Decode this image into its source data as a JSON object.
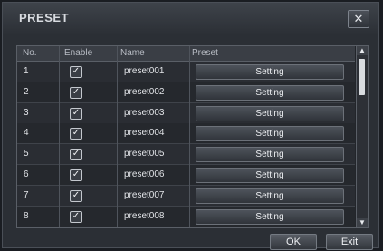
{
  "dialog": {
    "title": "PRESET",
    "close_glyph": "✕",
    "close_icon": "close-icon"
  },
  "table": {
    "headers": {
      "no": "No.",
      "enable": "Enable",
      "name": "Name",
      "preset": "Preset"
    },
    "rows": [
      {
        "no": "1",
        "enabled": true,
        "name": "preset001",
        "action": "Setting"
      },
      {
        "no": "2",
        "enabled": true,
        "name": "preset002",
        "action": "Setting"
      },
      {
        "no": "3",
        "enabled": true,
        "name": "preset003",
        "action": "Setting"
      },
      {
        "no": "4",
        "enabled": true,
        "name": "preset004",
        "action": "Setting"
      },
      {
        "no": "5",
        "enabled": true,
        "name": "preset005",
        "action": "Setting"
      },
      {
        "no": "6",
        "enabled": true,
        "name": "preset006",
        "action": "Setting"
      },
      {
        "no": "7",
        "enabled": true,
        "name": "preset007",
        "action": "Setting"
      },
      {
        "no": "8",
        "enabled": true,
        "name": "preset008",
        "action": "Setting"
      }
    ],
    "check_glyph": "✓"
  },
  "footer": {
    "ok_label": "OK",
    "exit_label": "Exit"
  }
}
